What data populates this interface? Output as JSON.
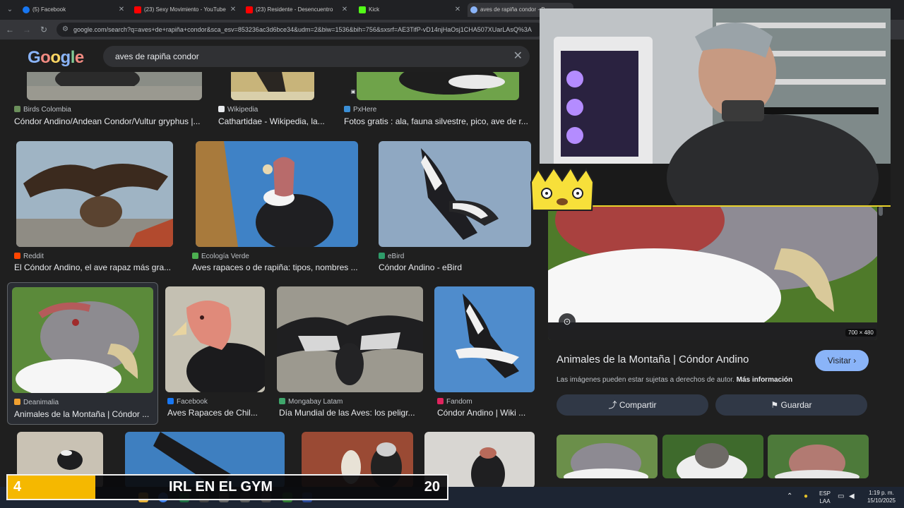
{
  "browser": {
    "tabs": [
      {
        "label": "(5) Facebook",
        "color": "#1877f2",
        "active": false
      },
      {
        "label": "(23) Sexy Movimiento - YouTube",
        "color": "#ff0000",
        "active": false
      },
      {
        "label": "(23) Residente - Desencuentro",
        "color": "#ff0000",
        "active": false
      },
      {
        "label": "Kick",
        "color": "#53fc18",
        "active": false
      },
      {
        "label": "aves de rapiña condor - B",
        "color": "#8ab4f8",
        "active": true
      }
    ],
    "url": "google.com/search?q=aves+de+rapiña+condor&sca_esv=853236ac3d6bce34&udm=2&biw=1536&bih=756&sxsrf=AE3TifP-vD14njHaOsj1CHA507XUarLAsQ%3A"
  },
  "google": {
    "logo": "Google",
    "query": "aves de rapiña condor"
  },
  "results": {
    "row1": [
      {
        "source": "Birds Colombia",
        "title": "Cóndor Andino/Andean Condor/Vultur gryphus |...",
        "icon_color": "#6b8f5b"
      },
      {
        "source": "Wikipedia",
        "title": "Cathartidae - Wikipedia, la...",
        "icon_color": "#e8eaed"
      },
      {
        "source": "PxHere",
        "title": "Fotos gratis : ala, fauna silvestre, pico, ave de r...",
        "icon_color": "#3b8fd6"
      }
    ],
    "row2": [
      {
        "source": "Reddit",
        "title": "El Cóndor Andino, el ave rapaz más gra...",
        "icon_color": "#ff4500"
      },
      {
        "source": "Ecología Verde",
        "title": "Aves rapaces o de rapiña: tipos, nombres ...",
        "icon_color": "#4caf50"
      },
      {
        "source": "eBird",
        "title": "Cóndor Andino - eBird",
        "icon_color": "#2e9c6a"
      }
    ],
    "row3": [
      {
        "source": "Deanimalia",
        "title": "Animales de la Montaña | Cóndor ...",
        "icon_color": "#f0a030"
      },
      {
        "source": "Facebook",
        "title": "Aves Rapaces de Chil...",
        "icon_color": "#1877f2"
      },
      {
        "source": "Mongabay Latam",
        "title": "Día Mundial de las Aves: los peligr...",
        "icon_color": "#3fa66b"
      },
      {
        "source": "Fandom",
        "title": "Cóndor Andino | Wiki ...",
        "icon_color": "#e0245e"
      }
    ]
  },
  "preview": {
    "dimensions": "700 × 480",
    "title": "Animales de la Montaña | Cóndor Andino",
    "visit_label": "Visitar",
    "notice": "Las imágenes pueden estar sujetas a derechos de autor.",
    "more_info": "Más información",
    "share_label": "Compartir",
    "save_label": "Guardar"
  },
  "overlay": {
    "count": "4",
    "goal_text": "IRL EN EL GYM",
    "target": "20",
    "progress": 0.2
  },
  "taskbar": {
    "lang_top": "ESP",
    "lang_bottom": "LAA",
    "time": "1:19 p. m.",
    "date": "15/10/2025"
  }
}
